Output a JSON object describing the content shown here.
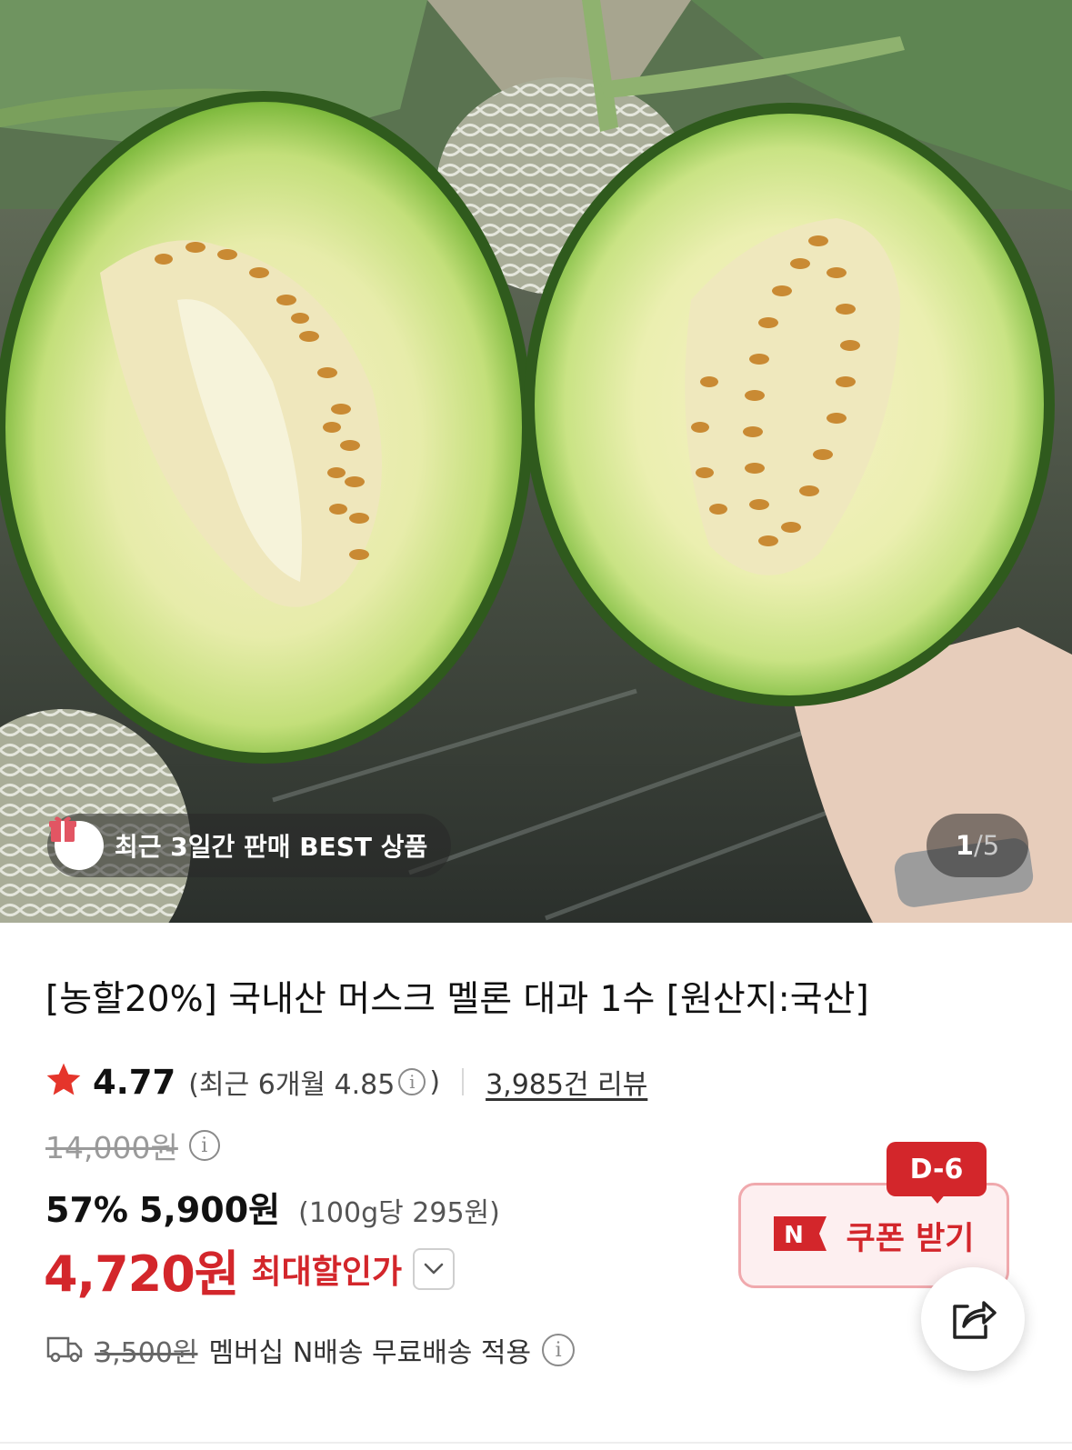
{
  "hero": {
    "image_description_icon": "melon-photo",
    "best_badge": {
      "icon": "gift-box-icon",
      "text": "최근 3일간 판매 BEST 상품"
    },
    "pagination": {
      "current": "1",
      "separator": "/",
      "total": "5"
    }
  },
  "product": {
    "title": "[농할20%] 국내산 머스크 멜론 대과 1수 [원산지:국산]"
  },
  "rating": {
    "icon": "star-icon",
    "value": "4.77",
    "recent_prefix": "(최근 6개월 4.85",
    "recent_suffix": ")",
    "info_glyph": "i",
    "reviews": "3,985건 리뷰"
  },
  "price": {
    "original": "14,000원",
    "info_glyph": "i",
    "discount_rate": "57%",
    "sale": "5,900원",
    "unit_price": "(100g당 295원)",
    "max_discount_price": "4,720원",
    "max_discount_label": "최대할인가"
  },
  "shipping": {
    "icon": "truck-icon",
    "old_fee": "3,500원",
    "text": "멤버십 N배송 무료배송 적용",
    "info_glyph": "i"
  },
  "coupon": {
    "badge": "D-6",
    "logo": "N",
    "label": "쿠폰 받기"
  },
  "colors": {
    "accent_red": "#d3262b",
    "coupon_bg": "#fdeff0",
    "coupon_border": "#f0a9ad",
    "star": "#e5352b"
  }
}
